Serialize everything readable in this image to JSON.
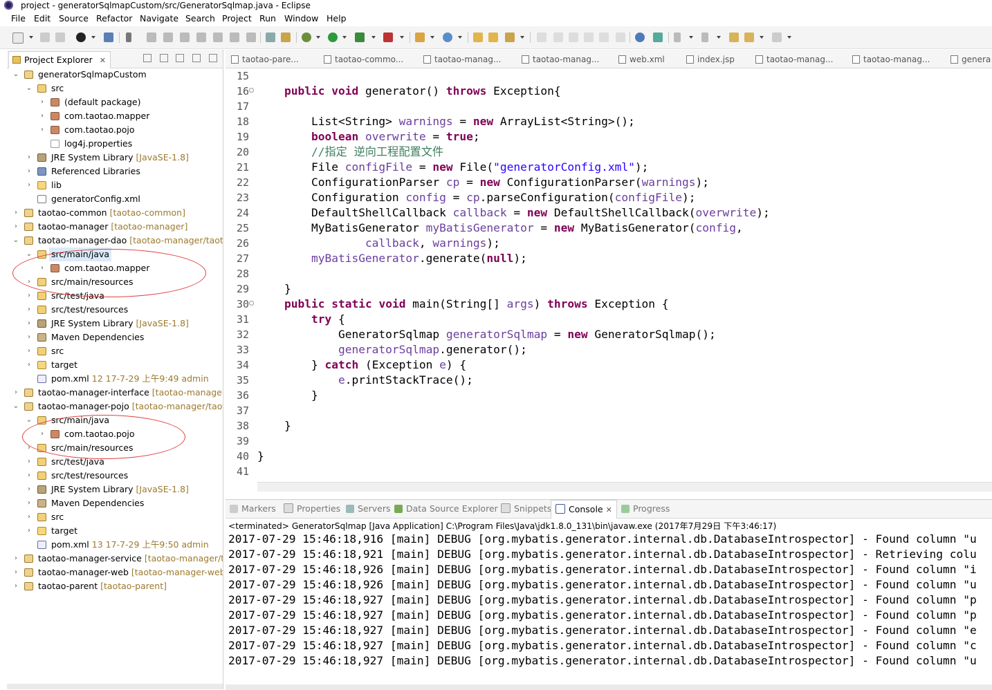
{
  "window": {
    "title": "project - generatorSqlmapCustom/src/GeneratorSqlmap.java - Eclipse"
  },
  "menu": [
    "File",
    "Edit",
    "Source",
    "Refactor",
    "Navigate",
    "Search",
    "Project",
    "Run",
    "Window",
    "Help"
  ],
  "explorer": {
    "tab_label": "Project Explorer",
    "close_glyph": "✕",
    "tree": [
      {
        "label": "generatorSqlmapCustom",
        "deco": "",
        "arrow": "⌄",
        "icon": "project"
      },
      {
        "label": "src",
        "deco": "",
        "arrow": "⌄",
        "icon": "source-folder"
      },
      {
        "label": "(default package)",
        "deco": "",
        "arrow": "›",
        "icon": "package"
      },
      {
        "label": "com.taotao.mapper",
        "deco": "",
        "arrow": "›",
        "icon": "package"
      },
      {
        "label": "com.taotao.pojo",
        "deco": "",
        "arrow": "›",
        "icon": "package"
      },
      {
        "label": "log4j.properties",
        "deco": "",
        "arrow": "",
        "icon": "file"
      },
      {
        "label": "JRE System Library",
        "deco": "[JavaSE-1.8]",
        "arrow": "›",
        "icon": "jre-library"
      },
      {
        "label": "Referenced Libraries",
        "deco": "",
        "arrow": "›",
        "icon": "library"
      },
      {
        "label": "lib",
        "deco": "",
        "arrow": "›",
        "icon": "folder"
      },
      {
        "label": "generatorConfig.xml",
        "deco": "",
        "arrow": "",
        "icon": "xml-file"
      },
      {
        "label": "taotao-common",
        "deco": "[taotao-common]",
        "arrow": "›",
        "icon": "project"
      },
      {
        "label": "taotao-manager",
        "deco": "[taotao-manager]",
        "arrow": "›",
        "icon": "project"
      },
      {
        "label": "taotao-manager-dao",
        "deco": "[taotao-manager/taota",
        "arrow": "⌄",
        "icon": "project"
      },
      {
        "label": "src/main/java",
        "deco": "",
        "arrow": "⌄",
        "icon": "source-folder"
      },
      {
        "label": "com.taotao.mapper",
        "deco": "",
        "arrow": "›",
        "icon": "package"
      },
      {
        "label": "src/main/resources",
        "deco": "",
        "arrow": "›",
        "icon": "source-folder"
      },
      {
        "label": "src/test/java",
        "deco": "",
        "arrow": "›",
        "icon": "source-folder"
      },
      {
        "label": "src/test/resources",
        "deco": "",
        "arrow": "›",
        "icon": "source-folder"
      },
      {
        "label": "JRE System Library",
        "deco": "[JavaSE-1.8]",
        "arrow": "›",
        "icon": "jre-library"
      },
      {
        "label": "Maven Dependencies",
        "deco": "",
        "arrow": "›",
        "icon": "maven-library"
      },
      {
        "label": "src",
        "deco": "",
        "arrow": "›",
        "icon": "source-folder"
      },
      {
        "label": "target",
        "deco": "",
        "arrow": "›",
        "icon": "folder"
      },
      {
        "label": "pom.xml",
        "deco": "12  17-7-29 上午9:49  admin",
        "arrow": "",
        "icon": "pom-file"
      },
      {
        "label": "taotao-manager-interface",
        "deco": "[taotao-manager/t",
        "arrow": "›",
        "icon": "project"
      },
      {
        "label": "taotao-manager-pojo",
        "deco": "[taotao-manager/taota",
        "arrow": "⌄",
        "icon": "project"
      },
      {
        "label": "src/main/java",
        "deco": "",
        "arrow": "⌄",
        "icon": "source-folder"
      },
      {
        "label": "com.taotao.pojo",
        "deco": "",
        "arrow": "›",
        "icon": "package"
      },
      {
        "label": "src/main/resources",
        "deco": "",
        "arrow": "›",
        "icon": "source-folder"
      },
      {
        "label": "src/test/java",
        "deco": "",
        "arrow": "›",
        "icon": "source-folder"
      },
      {
        "label": "src/test/resources",
        "deco": "",
        "arrow": "›",
        "icon": "source-folder"
      },
      {
        "label": "JRE System Library",
        "deco": "[JavaSE-1.8]",
        "arrow": "›",
        "icon": "jre-library"
      },
      {
        "label": "Maven Dependencies",
        "deco": "",
        "arrow": "›",
        "icon": "maven-library"
      },
      {
        "label": "src",
        "deco": "",
        "arrow": "›",
        "icon": "source-folder"
      },
      {
        "label": "target",
        "deco": "",
        "arrow": "›",
        "icon": "folder"
      },
      {
        "label": "pom.xml",
        "deco": "13  17-7-29 上午9:50  admin",
        "arrow": "",
        "icon": "pom-file"
      },
      {
        "label": "taotao-manager-service",
        "deco": "[taotao-manager/tao",
        "arrow": "›",
        "icon": "project"
      },
      {
        "label": "taotao-manager-web",
        "deco": "[taotao-manager-web]",
        "arrow": "›",
        "icon": "project"
      },
      {
        "label": "taotao-parent",
        "deco": "[taotao-parent]",
        "arrow": "›",
        "icon": "project"
      }
    ]
  },
  "editor_tabs": [
    "taotao-pare...",
    "taotao-commo...",
    "taotao-manag...",
    "taotao-manag...",
    "web.xml",
    "index.jsp",
    "taotao-manag...",
    "taotao-manag...",
    "genera"
  ],
  "editor": {
    "line_numbers": [
      "15",
      "16",
      "17",
      "18",
      "19",
      "20",
      "21",
      "22",
      "23",
      "24",
      "25",
      "26",
      "27",
      "28",
      "29",
      "30",
      "31",
      "32",
      "33",
      "34",
      "35",
      "36",
      "37",
      "38",
      "39",
      "40",
      "41"
    ]
  },
  "console": {
    "tabs": [
      "Markers",
      "Properties",
      "Servers",
      "Data Source Explorer",
      "Snippets",
      "Console",
      "Progress"
    ],
    "active_tab": "Console",
    "status": "<terminated> GeneratorSqlmap [Java Application] C:\\Program Files\\Java\\jdk1.8.0_131\\bin\\javaw.exe (2017年7月29日 下午3:46:17)",
    "lines": [
      "2017-07-29 15:46:18,916 [main] DEBUG [org.mybatis.generator.internal.db.DatabaseIntrospector] - Found column \"u",
      "2017-07-29 15:46:18,921 [main] DEBUG [org.mybatis.generator.internal.db.DatabaseIntrospector] - Retrieving colu",
      "2017-07-29 15:46:18,926 [main] DEBUG [org.mybatis.generator.internal.db.DatabaseIntrospector] - Found column \"i",
      "2017-07-29 15:46:18,926 [main] DEBUG [org.mybatis.generator.internal.db.DatabaseIntrospector] - Found column \"u",
      "2017-07-29 15:46:18,927 [main] DEBUG [org.mybatis.generator.internal.db.DatabaseIntrospector] - Found column \"p",
      "2017-07-29 15:46:18,927 [main] DEBUG [org.mybatis.generator.internal.db.DatabaseIntrospector] - Found column \"p",
      "2017-07-29 15:46:18,927 [main] DEBUG [org.mybatis.generator.internal.db.DatabaseIntrospector] - Found column \"e",
      "2017-07-29 15:46:18,927 [main] DEBUG [org.mybatis.generator.internal.db.DatabaseIntrospector] - Found column \"c",
      "2017-07-29 15:46:18,927 [main] DEBUG [org.mybatis.generator.internal.db.DatabaseIntrospector] - Found column \"u"
    ]
  },
  "code": {
    "l16": {
      "i": "    ",
      "k1": "public",
      "k2": "void",
      "t1": " generator() ",
      "k3": "throws",
      "t2": " Exception{"
    },
    "l18": {
      "i": "        ",
      "t1": "List<String> ",
      "v1": "warnings",
      "t2": " = ",
      "k1": "new",
      "t3": " ArrayList<String>();"
    },
    "l19": {
      "i": "        ",
      "k1": "boolean",
      "t1": " ",
      "v1": "overwrite",
      "t2": " = ",
      "k2": "true",
      "t3": ";"
    },
    "l20": {
      "i": "        ",
      "c1": "//指定 逆向工程配置文件"
    },
    "l21": {
      "i": "        ",
      "t1": "File ",
      "v1": "configFile",
      "t2": " = ",
      "k1": "new",
      "t3": " File(",
      "s1": "\"generatorConfig.xml\"",
      "t4": ");"
    },
    "l22": {
      "i": "        ",
      "t1": "ConfigurationParser ",
      "v1": "cp",
      "t2": " = ",
      "k1": "new",
      "t3": " ConfigurationParser(",
      "v2": "warnings",
      "t4": ");"
    },
    "l23": {
      "i": "        ",
      "t1": "Configuration ",
      "v1": "config",
      "t2": " = ",
      "v2": "cp",
      "t3": ".parseConfiguration(",
      "v3": "configFile",
      "t4": ");"
    },
    "l24": {
      "i": "        ",
      "t1": "DefaultShellCallback ",
      "v1": "callback",
      "t2": " = ",
      "k1": "new",
      "t3": " DefaultShellCallback(",
      "v2": "overwrite",
      "t4": ");"
    },
    "l25": {
      "i": "        ",
      "t1": "MyBatisGenerator ",
      "v1": "myBatisGenerator",
      "t2": " = ",
      "k1": "new",
      "t3": " MyBatisGenerator(",
      "v2": "config",
      "t4": ","
    },
    "l26": {
      "i": "                ",
      "v1": "callback",
      "t1": ", ",
      "v2": "warnings",
      "t2": ");"
    },
    "l27": {
      "i": "        ",
      "v1": "myBatisGenerator",
      "t1": ".generate(",
      "k1": "null",
      "t2": ");"
    },
    "l29": {
      "i": "    ",
      "t1": "}"
    },
    "l30": {
      "i": "    ",
      "k1": "public",
      "k2": "static",
      "k3": "void",
      "t1": " main(String[] ",
      "v1": "args",
      "t2": ") ",
      "k4": "throws",
      "t3": " Exception {"
    },
    "l31": {
      "i": "        ",
      "k1": "try",
      "t1": " {"
    },
    "l32": {
      "i": "            ",
      "t1": "GeneratorSqlmap ",
      "v1": "generatorSqlmap",
      "t2": " = ",
      "k1": "new",
      "t3": " GeneratorSqlmap();"
    },
    "l33": {
      "i": "            ",
      "v1": "generatorSqlmap",
      "t1": ".generator();"
    },
    "l34": {
      "i": "        ",
      "t1": "} ",
      "k1": "catch",
      "t2": " (Exception ",
      "v1": "e",
      "t3": ") {"
    },
    "l35": {
      "i": "            ",
      "v1": "e",
      "t1": ".printStackTrace();"
    },
    "l36": {
      "i": "        ",
      "t1": "}"
    },
    "l38": {
      "i": "    ",
      "t1": "}"
    },
    "l40": {
      "i": "",
      "t1": "}"
    }
  },
  "colors": {
    "keyword": "#7f0055",
    "variable": "#6a3e9e",
    "string": "#2a00ff",
    "comment": "#3f7f5f",
    "annotation_circle": "#e04040",
    "selection": "#dbeaf9"
  }
}
